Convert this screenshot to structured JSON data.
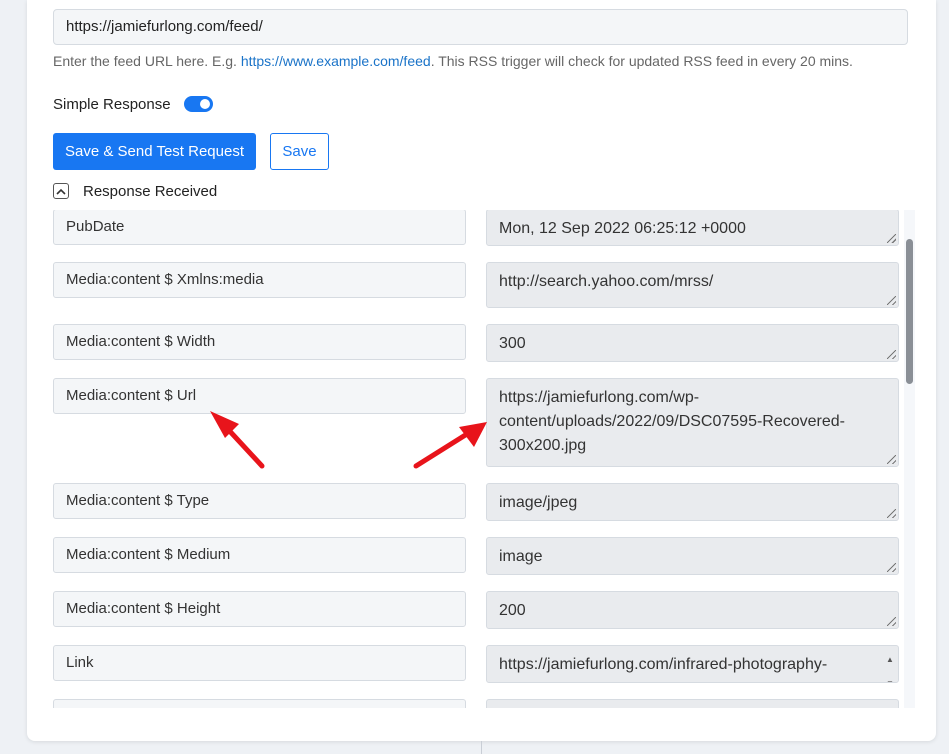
{
  "feed": {
    "url_value": "https://jamiefurlong.com/feed/",
    "hint_prefix": "Enter the feed URL here. E.g. ",
    "hint_link": "https://www.example.com/feed",
    "hint_suffix": ". This RSS trigger will check for updated RSS feed in every 20 mins."
  },
  "simple_response": {
    "label": "Simple Response",
    "enabled": true
  },
  "actions": {
    "save_send_label": "Save & Send Test Request",
    "save_label": "Save"
  },
  "response": {
    "section_label": "Response Received",
    "collapse_icon": "chevron-up-icon",
    "rows": [
      {
        "key": "PubDate",
        "value": "Mon, 12 Sep 2022 06:25:12 +0000"
      },
      {
        "key": "Media:content $ Xmlns:media",
        "value": "http://search.yahoo.com/mrss/"
      },
      {
        "key": "Media:content $ Width",
        "value": "300"
      },
      {
        "key": "Media:content $ Url",
        "value": "https://jamiefurlong.com/wp-content/uploads/2022/09/DSC07595-Recovered-300x200.jpg"
      },
      {
        "key": "Media:content $ Type",
        "value": "image/jpeg"
      },
      {
        "key": "Media:content $ Medium",
        "value": "image"
      },
      {
        "key": "Media:content $ Height",
        "value": "200"
      },
      {
        "key": "Link",
        "value": "https://jamiefurlong.com/infrared-photography-"
      }
    ]
  },
  "colors": {
    "accent": "#1877f2",
    "annotation_arrow": "#e8141b"
  }
}
